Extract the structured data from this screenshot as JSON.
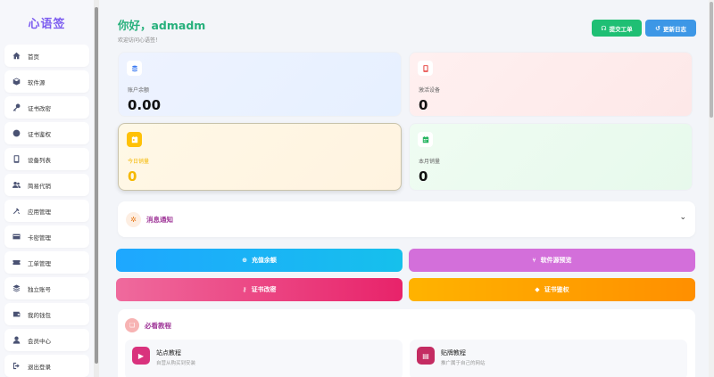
{
  "app": {
    "logo": "心语签"
  },
  "sidebar": {
    "items": [
      {
        "label": "首页",
        "icon": "home-icon"
      },
      {
        "label": "软件源",
        "icon": "cube-icon"
      },
      {
        "label": "证书改密",
        "icon": "key-icon"
      },
      {
        "label": "证书鉴权",
        "icon": "circle-icon"
      },
      {
        "label": "设备列表",
        "icon": "mobile-icon"
      },
      {
        "label": "简易代销",
        "icon": "users-icon"
      },
      {
        "label": "应用管理",
        "icon": "tools-icon"
      },
      {
        "label": "卡密管理",
        "icon": "card-icon"
      },
      {
        "label": "工单管理",
        "icon": "ticket-icon"
      },
      {
        "label": "独立账号",
        "icon": "layers-icon"
      },
      {
        "label": "我的钱包",
        "icon": "wallet-icon"
      },
      {
        "label": "会员中心",
        "icon": "user-icon"
      },
      {
        "label": "退出登录",
        "icon": "logout-icon"
      }
    ]
  },
  "header": {
    "greeting": "你好，admadm",
    "subtitle": "欢迎访问心语签！",
    "submit_ticket": "提交工单",
    "update_log": "更新日志"
  },
  "stats": {
    "balance": {
      "label": "账户余额",
      "value": "0.00"
    },
    "devices": {
      "label": "激活设备",
      "value": "0"
    },
    "today": {
      "label": "今日销量",
      "value": "0"
    },
    "month": {
      "label": "本月销量",
      "value": "0"
    }
  },
  "notice": {
    "title": "消息通知"
  },
  "actions": {
    "recharge": "充值余额",
    "software_preview": "软件源预览",
    "cert_password": "证书改密",
    "cert_auth": "证书鉴权"
  },
  "tutorials": {
    "title": "必看教程",
    "items": [
      {
        "title": "站点教程",
        "desc": "自营从购买到安装"
      },
      {
        "title": "贴牌教程",
        "desc": "推广属于自己的网站"
      }
    ]
  },
  "colors": {
    "brand": "#7c5cf0",
    "greeting": "#27b07c",
    "accent_title": "#a13a9a"
  }
}
